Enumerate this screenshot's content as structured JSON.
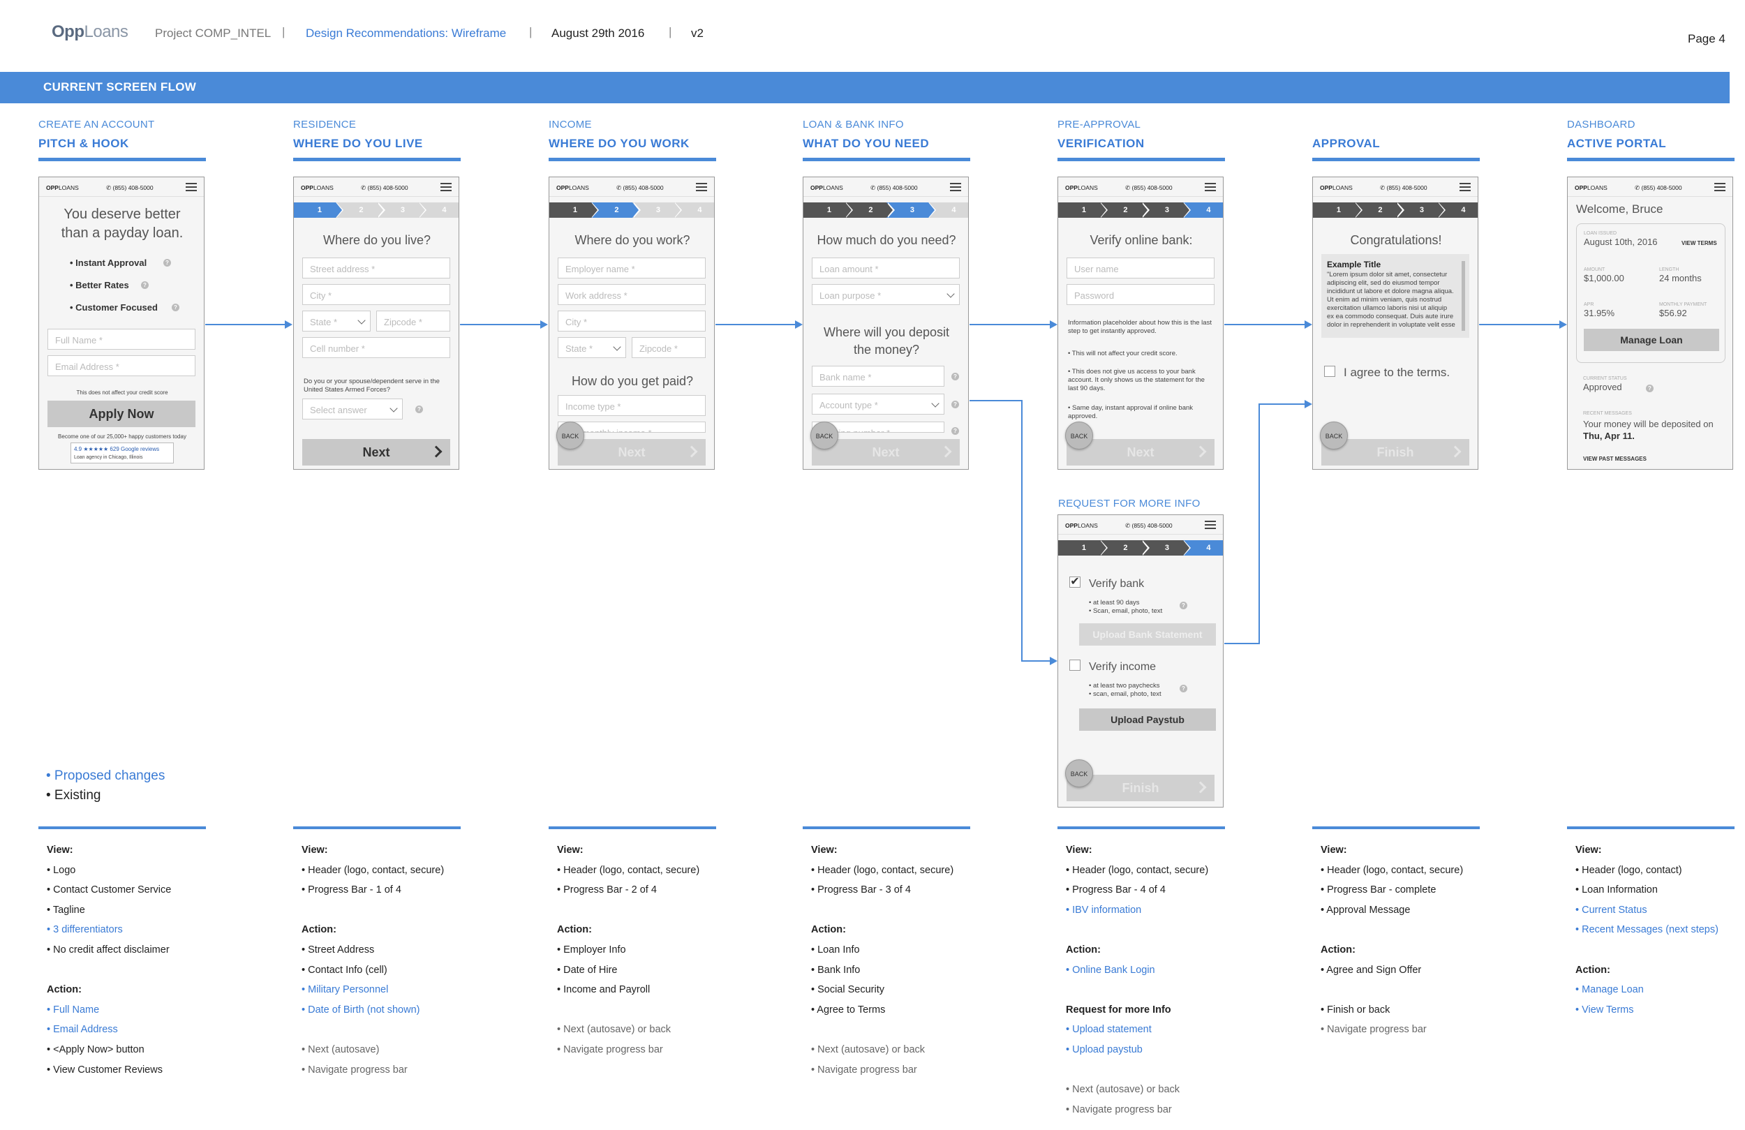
{
  "header": {
    "logo_a": "Opp",
    "logo_b": "Loans",
    "project": "Project COMP_INTEL",
    "design": "Design Recommendations: Wireframe",
    "date": "August 29th  2016",
    "version": "v2",
    "page": "Page 4",
    "sep": "|"
  },
  "banner": "CURRENT SCREEN FLOW",
  "columns": [
    {
      "cat": "CREATE AN ACCOUNT",
      "name": "PITCH & HOOK"
    },
    {
      "cat": "RESIDENCE",
      "name": "WHERE DO YOU LIVE"
    },
    {
      "cat": "INCOME",
      "name": "WHERE DO YOU WORK"
    },
    {
      "cat": "LOAN & BANK INFO",
      "name": "WHAT DO YOU NEED"
    },
    {
      "cat": "PRE-APPROVAL",
      "name": "VERIFICATION"
    },
    {
      "cat": "",
      "name": "APPROVAL"
    },
    {
      "cat": "DASHBOARD",
      "name": "ACTIVE PORTAL"
    }
  ],
  "request_more": "REQUEST FOR MORE INFO",
  "phone": {
    "logo_a": "OPP",
    "logo_b": "LOANS",
    "tel": "✆ (855) 408-5000",
    "back": "BACK",
    "next": "Next",
    "finish": "Finish",
    "steps": [
      "1",
      "2",
      "3",
      "4"
    ]
  },
  "s1": {
    "title": "You deserve better than a payday loan.",
    "items": [
      "• Instant Approval",
      "• Better Rates",
      "• Customer Focused"
    ],
    "full_name": "Full Name *",
    "email": "Email Address *",
    "disclaimer": "This does not affect your credit score",
    "apply": "Apply Now",
    "become": "Become one of our 25,000+ happy customers today",
    "rating": "4.9 ★★★★★ 629 Google reviews",
    "agency": "Loan agency in Chicago, Illinois"
  },
  "s2": {
    "title": "Where do you live?",
    "street": "Street address *",
    "city": "City *",
    "state": "State *",
    "zip": "Zipcode *",
    "cell": "Cell number *",
    "military": "Do you or your spouse/dependent serve in the United States Armed Forces?",
    "select": "Select answer"
  },
  "s3": {
    "title": "Where do you work?",
    "employer": "Employer name *",
    "work": "Work address *",
    "city": "City *",
    "state": "State *",
    "zip": "Zipcode *",
    "paid": "How do you get paid?",
    "income": "Income type *",
    "monthly": "Net monthly income *"
  },
  "s4": {
    "title": "How much do you need?",
    "amount": "Loan amount *",
    "purpose": "Loan purpose *",
    "deposit": "Where will you deposit the money?",
    "bank": "Bank name *",
    "account": "Account type *",
    "routing": "Routing number *"
  },
  "s5": {
    "title": "Verify online bank:",
    "user": "User name",
    "password": "Password",
    "info": "Information placeholder about how this is the last step to get instantly approved.",
    "b1": "• This will not affect your credit score.",
    "b2": "• This does not give us access to your bank account. It only shows us the statement for the last 90 days.",
    "b3": "• Same day, instant approval if online bank approved."
  },
  "s6": {
    "title": "Congratulations!",
    "ex_title": "Example Title",
    "ex_body": "\"Lorem ipsum dolor sit amet, consectetur adipiscing elit, sed do eiusmod tempor incididunt ut labore et dolore magna aliqua. Ut enim ad minim veniam, quis nostrud exercitation ullamco laboris nisi ut aliquip ex ea commodo consequat. Duis aute irure dolor in reprehenderit in voluptate velit esse",
    "agree": "I agree to the terms."
  },
  "s7": {
    "welcome": "Welcome, Bruce",
    "issued_l": "LOAN ISSUED",
    "issued": "August 10th, 2016",
    "view_terms": "VIEW TERMS",
    "amount_l": "AMOUNT",
    "amount": "$1,000.00",
    "length_l": "LENGTH",
    "length": "24 months",
    "apr_l": "APR",
    "apr": "31.95%",
    "mp_l": "MONTHLY PAYMENT",
    "mp": "$56.92",
    "manage": "Manage Loan",
    "status_l": "CURRENT STATUS",
    "status": "Approved",
    "msg_l": "RECENT MESSAGES",
    "msg_a": "Your money will be deposited on ",
    "msg_b": "Thu, Apr 11.",
    "view_past": "VIEW PAST MESSAGES"
  },
  "s8": {
    "verify_bank": "Verify bank",
    "vb1": "• at least 90 days",
    "vb2": "• Scan, email, photo, text",
    "upload_bank": "Upload Bank Statement",
    "verify_income": "Verify income",
    "vi1": "• at least two paychecks",
    "vi2": "• scan, email, photo, text",
    "upload_pay": "Upload Paystub"
  },
  "legend": {
    "proposed": "• Proposed changes",
    "existing": "• Existing"
  },
  "notes": [
    [
      [
        "h",
        "View:"
      ],
      [
        "",
        "• Logo"
      ],
      [
        "",
        "• Contact Customer Service"
      ],
      [
        "",
        "• Tagline"
      ],
      [
        "p",
        "• 3 differentiators"
      ],
      [
        "",
        "• No credit affect disclaimer"
      ],
      [
        "g",
        ""
      ],
      [
        "h",
        "Action:"
      ],
      [
        "p",
        "• Full Name"
      ],
      [
        "p",
        "• Email Address"
      ],
      [
        "",
        "• <Apply Now> button"
      ],
      [
        "",
        "• View Customer Reviews"
      ]
    ],
    [
      [
        "h",
        "View:"
      ],
      [
        "",
        "• Header (logo, contact, secure)"
      ],
      [
        "",
        "• Progress Bar - 1 of 4"
      ],
      [
        "g",
        ""
      ],
      [
        "h",
        "Action:"
      ],
      [
        "",
        "• Street Address"
      ],
      [
        "",
        "• Contact Info (cell)"
      ],
      [
        "p",
        "• Military Personnel"
      ],
      [
        "p",
        "• Date of Birth (not shown)"
      ],
      [
        "g",
        ""
      ],
      [
        "gr",
        "• Next (autosave)"
      ],
      [
        "gr",
        "• Navigate progress bar"
      ]
    ],
    [
      [
        "h",
        "View:"
      ],
      [
        "",
        "• Header (logo, contact, secure)"
      ],
      [
        "",
        "• Progress Bar - 2 of 4"
      ],
      [
        "g",
        ""
      ],
      [
        "h",
        "Action:"
      ],
      [
        "",
        "• Employer Info"
      ],
      [
        "",
        "• Date of Hire"
      ],
      [
        "",
        "• Income and Payroll"
      ],
      [
        "g",
        ""
      ],
      [
        "gr",
        "• Next (autosave) or back"
      ],
      [
        "gr",
        "• Navigate progress bar"
      ]
    ],
    [
      [
        "h",
        "View:"
      ],
      [
        "",
        "• Header (logo, contact, secure)"
      ],
      [
        "",
        "• Progress Bar - 3 of 4"
      ],
      [
        "g",
        ""
      ],
      [
        "h",
        "Action:"
      ],
      [
        "",
        "• Loan Info"
      ],
      [
        "",
        "• Bank Info"
      ],
      [
        "",
        "• Social Security"
      ],
      [
        "",
        "• Agree to Terms"
      ],
      [
        "g",
        ""
      ],
      [
        "gr",
        "• Next (autosave) or back"
      ],
      [
        "gr",
        "• Navigate progress bar"
      ]
    ],
    [
      [
        "h",
        "View:"
      ],
      [
        "",
        "• Header (logo, contact, secure)"
      ],
      [
        "",
        "• Progress Bar - 4 of 4"
      ],
      [
        "p",
        "• IBV information"
      ],
      [
        "g",
        ""
      ],
      [
        "h",
        "Action:"
      ],
      [
        "p",
        "• Online Bank Login"
      ],
      [
        "g",
        ""
      ],
      [
        "h",
        "Request for more Info"
      ],
      [
        "p",
        "• Upload statement"
      ],
      [
        "p",
        "• Upload paystub"
      ],
      [
        "g",
        ""
      ],
      [
        "gr",
        "• Next (autosave) or back"
      ],
      [
        "gr",
        "• Navigate progress bar"
      ]
    ],
    [
      [
        "h",
        "View:"
      ],
      [
        "",
        "• Header (logo, contact, secure)"
      ],
      [
        "",
        "• Progress Bar - complete"
      ],
      [
        "",
        "• Approval Message"
      ],
      [
        "g",
        ""
      ],
      [
        "h",
        "Action:"
      ],
      [
        "",
        "• Agree and Sign Offer"
      ],
      [
        "g",
        ""
      ],
      [
        "",
        "• Finish or back"
      ],
      [
        "gr",
        "• Navigate progress bar"
      ]
    ],
    [
      [
        "h",
        "View:"
      ],
      [
        "",
        "• Header (logo, contact)"
      ],
      [
        "",
        "• Loan Information"
      ],
      [
        "p",
        "• Current Status"
      ],
      [
        "p",
        "• Recent Messages (next steps)"
      ],
      [
        "g",
        ""
      ],
      [
        "h",
        "Action:"
      ],
      [
        "p",
        "• Manage Loan"
      ],
      [
        "p",
        "• View Terms"
      ]
    ]
  ]
}
